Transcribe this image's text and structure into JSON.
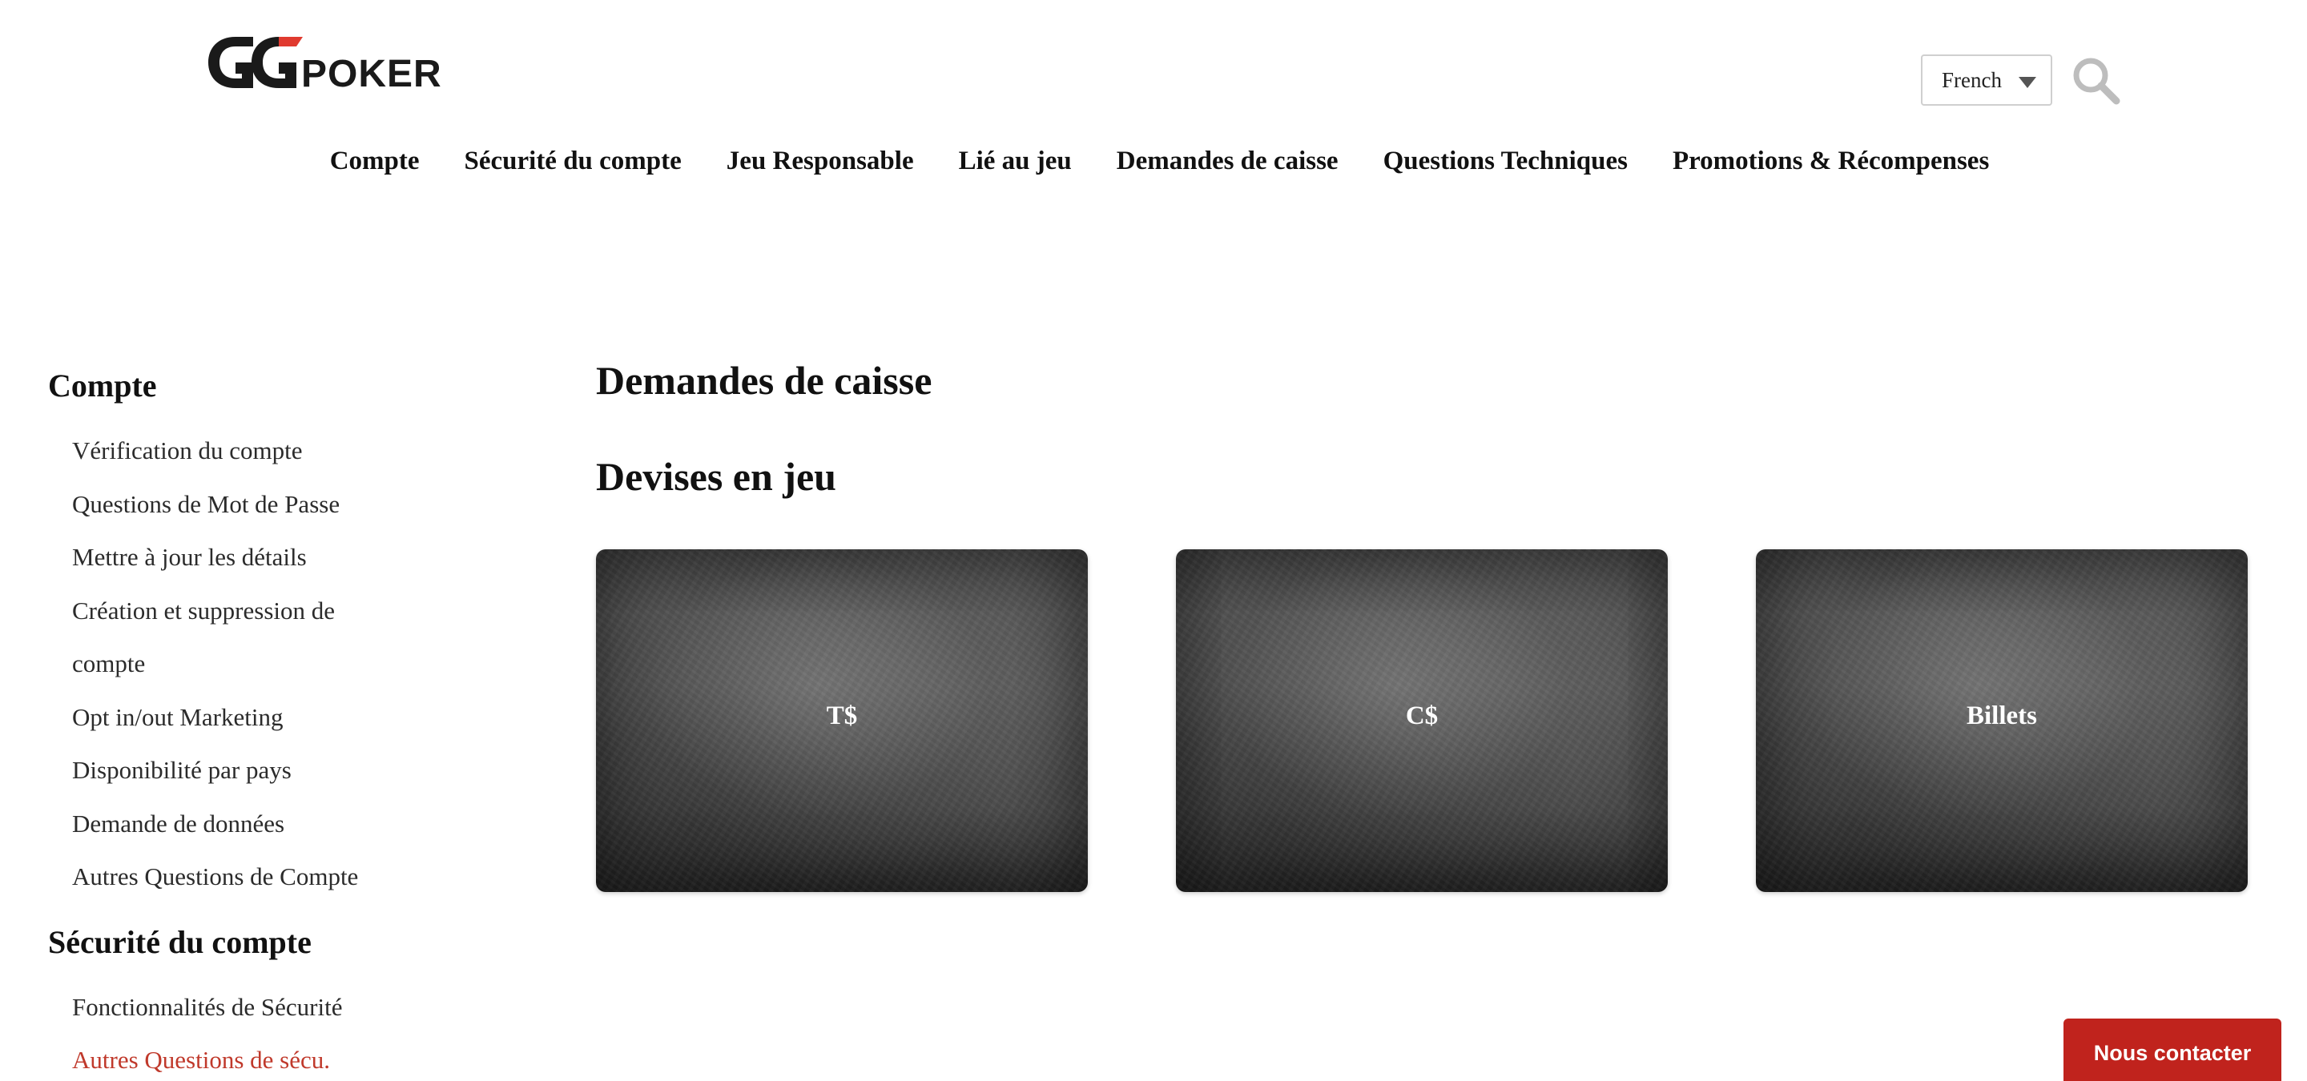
{
  "header": {
    "logo_icon": "ggpoker-logo",
    "logo_letters": "GG",
    "logo_word": "POKER",
    "language": {
      "selected": "French",
      "icon": "caret-down-icon"
    },
    "search_icon": "search-icon"
  },
  "topnav": {
    "items": [
      {
        "label": "Compte"
      },
      {
        "label": "Sécurité du compte"
      },
      {
        "label": "Jeu Responsable"
      },
      {
        "label": "Lié au jeu"
      },
      {
        "label": "Demandes de caisse"
      },
      {
        "label": "Questions Techniques"
      },
      {
        "label": "Promotions & Récompenses"
      }
    ]
  },
  "sidebar": {
    "sections": [
      {
        "heading": "Compte",
        "items": [
          {
            "label": "Vérification du compte"
          },
          {
            "label": "Questions de Mot de Passe"
          },
          {
            "label": "Mettre à jour les détails"
          },
          {
            "label": "Création et suppression de compte"
          },
          {
            "label": "Opt in/out Marketing"
          },
          {
            "label": "Disponibilité par pays"
          },
          {
            "label": "Demande de données"
          },
          {
            "label": "Autres Questions de Compte"
          }
        ]
      },
      {
        "heading": "Sécurité du compte",
        "items": [
          {
            "label": "Fonctionnalités de Sécurité"
          },
          {
            "label": "Autres Questions de sécu.",
            "active": true
          }
        ]
      }
    ]
  },
  "main": {
    "title": "Demandes de caisse",
    "section_title": "Devises en jeu",
    "cards": [
      {
        "label": "T$"
      },
      {
        "label": "C$"
      },
      {
        "label": "Billets"
      }
    ]
  },
  "contact_button": {
    "label": "Nous contacter"
  },
  "colors": {
    "accent": "#c0231d",
    "active_link": "#c0392b",
    "logo_red": "#e03a2f",
    "text": "#111111"
  }
}
